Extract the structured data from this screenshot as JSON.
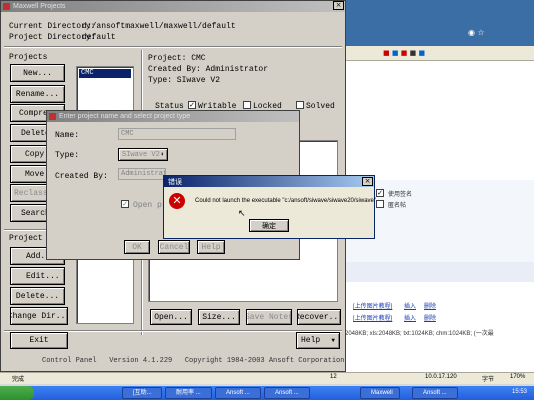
{
  "maxwell": {
    "title": "Maxwell Projects",
    "current_dir_label": "Current Directory:",
    "current_dir_value": "d:/ansoftmaxwell/maxwell/default",
    "project_dir_label": "Project Directory:",
    "project_dir_value": "default",
    "projects_label": "Projects",
    "project_list": [
      "CMC"
    ],
    "project_buttons": [
      "New...",
      "Rename...",
      "Compress...",
      "Delete...",
      "Copy...",
      "Move...",
      "Reclassify...",
      "Search..."
    ],
    "project_dir_section": "Project Directories",
    "dir_buttons": [
      "Add...",
      "Edit...",
      "Delete...",
      "Change Dir..."
    ],
    "info": {
      "project": "Project: CMC",
      "created_by": "Created By: Administrator",
      "type": "Type: SIwave V2"
    },
    "status": {
      "label": "Status",
      "writable": "Writable",
      "locked": "Locked",
      "solved": "Solved"
    },
    "bottom_buttons": [
      "Open...",
      "Size...",
      "Save Notes",
      "Recover..."
    ],
    "exit_label": "Exit",
    "help_label": "Help",
    "footer": "Control Panel   Version 4.1.229   Copyright 1984-2003 Ansoft Corporation"
  },
  "dialog": {
    "title": "Enter project name and select project type",
    "name_label": "Name:",
    "name_value": "CMC",
    "type_label": "Type:",
    "type_value": "SIwave V2",
    "created_label": "Created By:",
    "created_value": "Administrator",
    "open_label": "Open project",
    "ok_label": "OK",
    "cancel_label": "Cancel",
    "help_label": "Help"
  },
  "error": {
    "title": "错误",
    "message": "Could not launch the executable \"c:/ansoft/siwave/siwave20/siwave\"",
    "ok_label": "确定"
  },
  "background": {
    "checkbox_sign": "使用签名",
    "checkbox_anon": "匿名帖",
    "links": [
      "[上传图片教程]",
      "插入",
      "删除"
    ],
    "file_info": "2048KB; xls:2048KB; txt:1024KB; chm:1024KB; (一次最",
    "links2": [
      "[上传图片教程]",
      "插入",
      "删除"
    ]
  },
  "taskbar": {
    "status_text": "完成",
    "items": [
      "[互助...",
      "耐用率 ...",
      "Ansoft ...",
      "Ansoft ...",
      "Maxwell",
      "Ansoft ..."
    ],
    "tray_num": "12",
    "net_ip": "10.0.17.120",
    "char_label": "字节",
    "percent": "170%",
    "time": "15:53"
  },
  "colors": {
    "titlebar": "#0a246a",
    "taskbar": "#245edb",
    "error_red": "#cc0000"
  }
}
